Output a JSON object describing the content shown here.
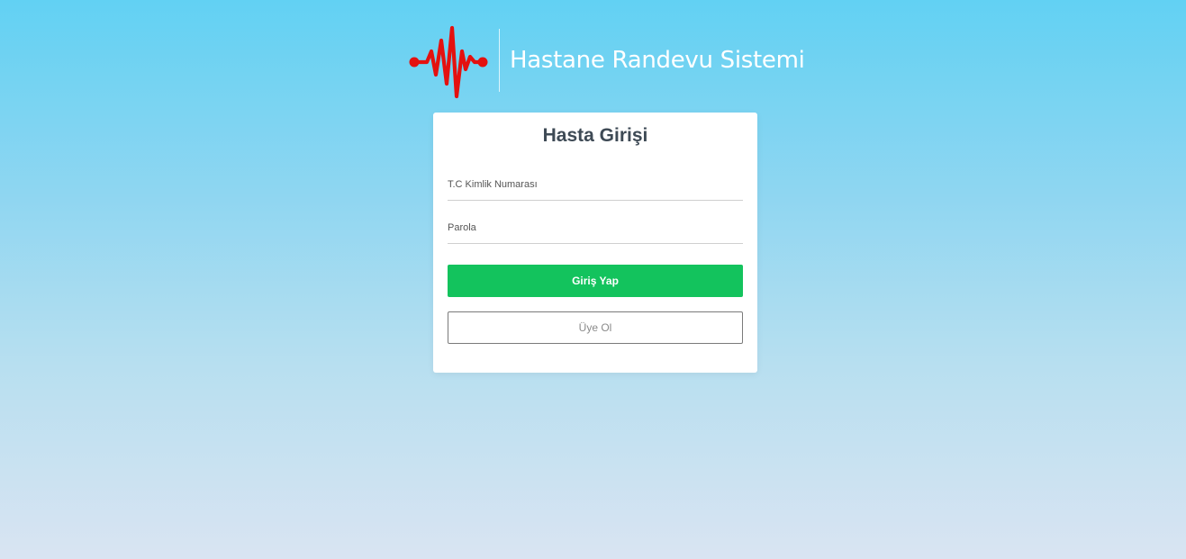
{
  "brand": {
    "title": "Hastane Randevu Sistemi",
    "logo_icon": "heartbeat-icon",
    "logo_color": "#e4110f"
  },
  "login_card": {
    "title": "Hasta Girişi",
    "tc_field": {
      "placeholder": "T.C Kimlik Numarası",
      "value": ""
    },
    "password_field": {
      "placeholder": "Parola",
      "value": ""
    },
    "login_button": {
      "label": "Giriş Yap",
      "color": "#13c35d"
    },
    "register_button": {
      "label": "Üye Ol"
    }
  }
}
